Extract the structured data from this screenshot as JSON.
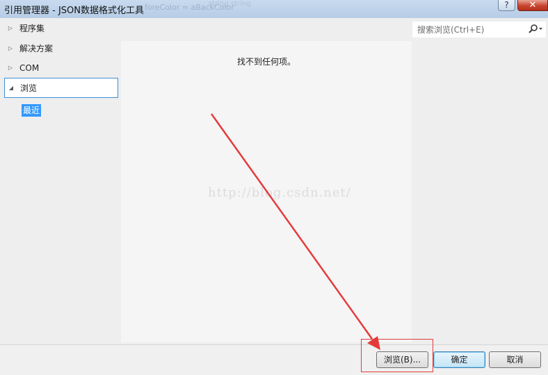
{
  "window": {
    "title": "引用管理器 - JSON数据格式化工具",
    "help_label": "?",
    "close_label": "✕"
  },
  "background_text": {
    "line1": "foreColor = aBackColor",
    "line2": "string      string"
  },
  "sidebar": {
    "items": [
      {
        "label": "程序集",
        "arrow": "collapsed"
      },
      {
        "label": "解决方案",
        "arrow": "collapsed"
      },
      {
        "label": "COM",
        "arrow": "collapsed"
      },
      {
        "label": "浏览",
        "arrow": "expanded",
        "selected": true
      }
    ],
    "sub_items": [
      {
        "label": "最近",
        "highlighted": true
      }
    ]
  },
  "content": {
    "empty_message": "找不到任何项。",
    "watermark": "http://blog.csdn.net/"
  },
  "search": {
    "placeholder": "搜索浏览(Ctrl+E)",
    "value": ""
  },
  "footer": {
    "browse_label": "浏览(B)...",
    "ok_label": "确定",
    "cancel_label": "取消"
  },
  "colors": {
    "selection_blue": "#3399ff",
    "selected_border": "#3e8ed6",
    "annotation_red": "#e53a3a"
  }
}
